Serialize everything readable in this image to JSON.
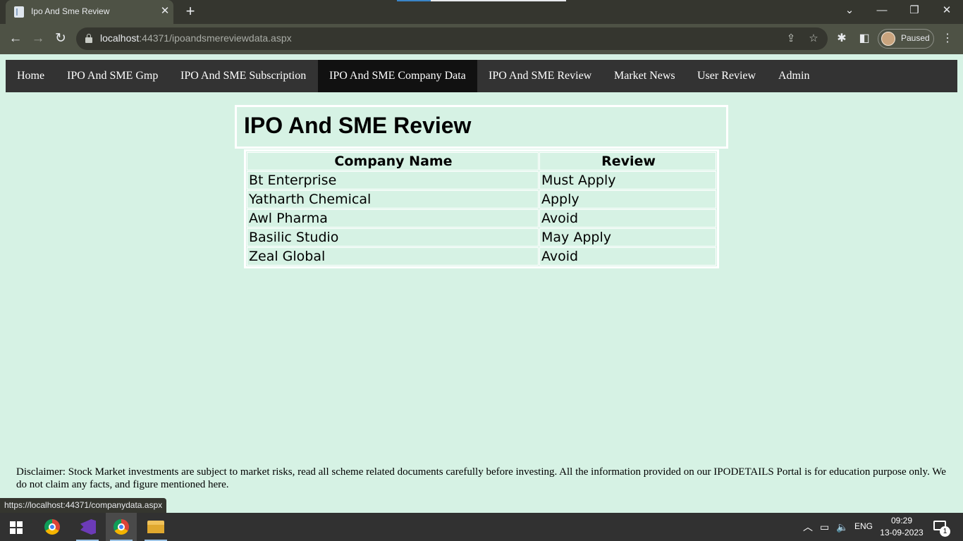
{
  "browser": {
    "tab_title": "Ipo And Sme Review",
    "url_host": "localhost",
    "url_rest": ":44371/ipoandsmereviewdata.aspx",
    "profile_label": "Paused",
    "status_url": "https://localhost:44371/companydata.aspx"
  },
  "nav": {
    "items": [
      {
        "label": "Home"
      },
      {
        "label": "IPO And SME Gmp"
      },
      {
        "label": "IPO And SME Subscription"
      },
      {
        "label": "IPO And SME Company Data",
        "active": true
      },
      {
        "label": "IPO And SME Review"
      },
      {
        "label": "Market News"
      },
      {
        "label": "User Review"
      },
      {
        "label": "Admin"
      }
    ]
  },
  "page": {
    "title": "IPO And SME Review"
  },
  "table": {
    "headers": [
      "Company Name",
      "Review"
    ],
    "rows": [
      {
        "company": "Bt Enterprise",
        "review": "Must Apply"
      },
      {
        "company": "Yatharth Chemical",
        "review": "Apply"
      },
      {
        "company": "Awl Pharma",
        "review": "Avoid"
      },
      {
        "company": "Basilic Studio",
        "review": "May Apply"
      },
      {
        "company": "Zeal Global",
        "review": "Avoid"
      }
    ]
  },
  "footer": {
    "disclaimer": "Disclaimer: Stock Market investments are subject to market risks, read all scheme related documents carefully before investing. All the information provided on our IPODETAILS Portal is for education purpose only. We do not claim any facts, and figure mentioned here."
  },
  "taskbar": {
    "language": "ENG",
    "time": "09:29",
    "date": "13-09-2023",
    "notification_count": "1",
    "apps": [
      "chrome-icon",
      "visual-studio-icon",
      "chrome-icon",
      "file-explorer-icon"
    ]
  }
}
